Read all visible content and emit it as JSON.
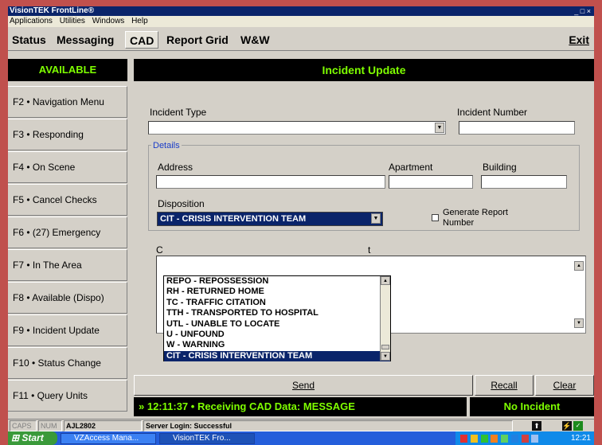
{
  "window": {
    "title": "VisionTEK FrontLine®",
    "controls": "_ □ ×"
  },
  "menu": [
    "Applications",
    "Utilities",
    "Windows",
    "Help"
  ],
  "tabs": [
    {
      "label": "Status"
    },
    {
      "label": "Messaging"
    },
    {
      "label": "CAD",
      "active": true
    },
    {
      "label": "Report Grid"
    },
    {
      "label": "W&W"
    }
  ],
  "exit_label": "Exit",
  "sidebar": {
    "status": "AVAILABLE",
    "items": [
      "F2 • Navigation Menu",
      "F3 • Responding",
      "F4 • On Scene",
      "F5 • Cancel Checks",
      "F6 • (27) Emergency",
      "F7 • In The Area",
      "F8 • Available (Dispo)",
      "F9 • Incident Update",
      "F10 • Status Change",
      "F11 • Query Units"
    ]
  },
  "form": {
    "title": "Incident Update",
    "incident_type_label": "Incident Type",
    "incident_type_value": "",
    "incident_number_label": "Incident Number",
    "incident_number_value": "",
    "details_title": "Details",
    "address_label": "Address",
    "apartment_label": "Apartment",
    "building_label": "Building",
    "disposition_label": "Disposition",
    "disposition_value": "CIT - CRISIS INTERVENTION TEAM",
    "generate_report_label_1": "Generate Report",
    "generate_report_label_2": "Number",
    "comments_label_fragment": "C",
    "comments_label_fragment2": "t",
    "disposition_options": [
      "REPO - REPOSSESSION",
      "RH - RETURNED HOME",
      "TC - TRAFFIC CITATION",
      "TTH - TRANSPORTED TO HOSPITAL",
      "UTL - UNABLE TO LOCATE",
      "U - UNFOUND",
      "W - WARNING",
      "CIT - CRISIS INTERVENTION TEAM"
    ],
    "selected_option_index": 7
  },
  "buttons": {
    "send": "Send",
    "recall": "Recall",
    "clear": "Clear"
  },
  "ticker": "» 12:11:37 • Receiving CAD Data: MESSAGE",
  "incident_status": "No Incident",
  "statusbar": {
    "caps": "CAPS",
    "num": "NUM",
    "unit": "AJL2802",
    "server": "Server Login: Successful"
  },
  "taskbar": {
    "start": "Start",
    "tasks": [
      "VZAccess Mana...",
      "VisionTEK Fro..."
    ],
    "clock": "12:21"
  },
  "colors": {
    "accent_green": "#7fff00",
    "header_black": "#000000",
    "selection_blue": "#0a246a",
    "frame_red": "#c0504d"
  }
}
